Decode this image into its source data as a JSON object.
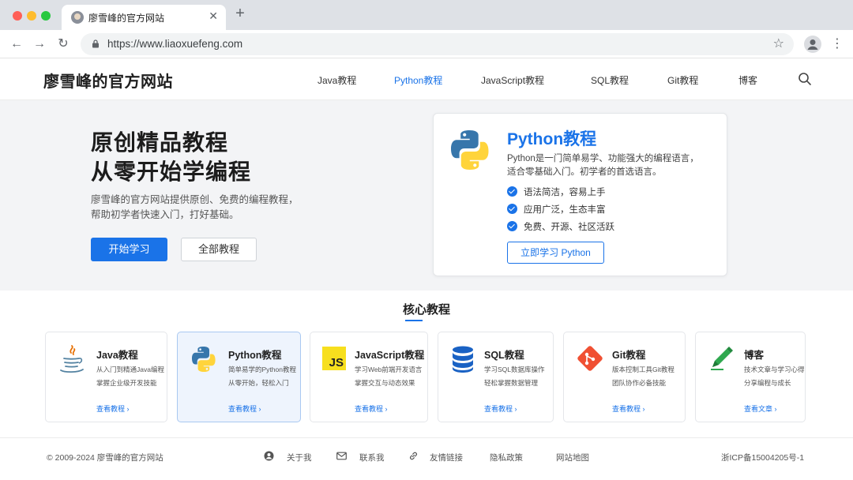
{
  "browser": {
    "tab_title": "廖雪峰的官方网站",
    "tab_close": "✕",
    "new_tab": "+",
    "url": "https://www.liaoxuefeng.com",
    "back": "←",
    "forward": "→",
    "reload": "↻",
    "star": "☆",
    "menu": "⋮"
  },
  "header": {
    "logo": "廖雪峰的官方网站",
    "nav": [
      "Java教程",
      "Python教程",
      "JavaScript教程",
      "SQL教程",
      "Git教程",
      "博客"
    ],
    "active_nav": "Python教程"
  },
  "hero": {
    "title_line1": "原创精品教程",
    "title_line2": "从零开始学编程",
    "desc_line1": "廖雪峰的官方网站提供原创、免费的编程教程，",
    "desc_line2": "帮助初学者快速入门，打好基础。",
    "primary_button": "开始学习",
    "secondary_button": "全部教程"
  },
  "feature": {
    "title": "Python教程",
    "desc_line1": "Python是一门简单易学、功能强大的编程语言，",
    "desc_line2": "适合零基础入门。初学者的首选语言。",
    "checks": [
      "语法简洁，容易上手",
      "应用广泛，生态丰富",
      "免费、开源、社区活跃"
    ],
    "button": "立即学习 Python"
  },
  "core": {
    "title": "核心教程",
    "courses": [
      {
        "title": "Java教程",
        "desc1": "从入门到精通Java编程",
        "desc2": "掌握企业级开发技能",
        "link": "查看教程 ›",
        "icon": "java-icon"
      },
      {
        "title": "Python教程",
        "desc1": "简单易学的Python教程",
        "desc2": "从零开始，轻松入门",
        "link": "查看教程 ›",
        "icon": "python-icon"
      },
      {
        "title": "JavaScript教程",
        "desc1": "学习Web前端开发语言",
        "desc2": "掌握交互与动态效果",
        "link": "查看教程 ›",
        "icon": "javascript-icon",
        "icon_text": "JS"
      },
      {
        "title": "SQL教程",
        "desc1": "学习SQL数据库操作",
        "desc2": "轻松掌握数据管理",
        "link": "查看教程 ›",
        "icon": "database-icon"
      },
      {
        "title": "Git教程",
        "desc1": "版本控制工具Git教程",
        "desc2": "团队协作必备技能",
        "link": "查看教程 ›",
        "icon": "git-icon"
      },
      {
        "title": "博客",
        "desc1": "技术文章与学习心得",
        "desc2": "分享编程与成长",
        "link": "查看文章 ›",
        "icon": "pencil-icon"
      }
    ]
  },
  "footer": {
    "copyright": "© 2009-2024 廖雪峰的官方网站",
    "about": "关于我",
    "contact": "联系我",
    "links": "友情链接",
    "privacy": "隐私政策",
    "sitemap": "网站地图",
    "icp": "浙ICP备15004205号-1"
  },
  "colors": {
    "accent": "#1a73e8",
    "hero_bg": "#f3f4f6"
  }
}
